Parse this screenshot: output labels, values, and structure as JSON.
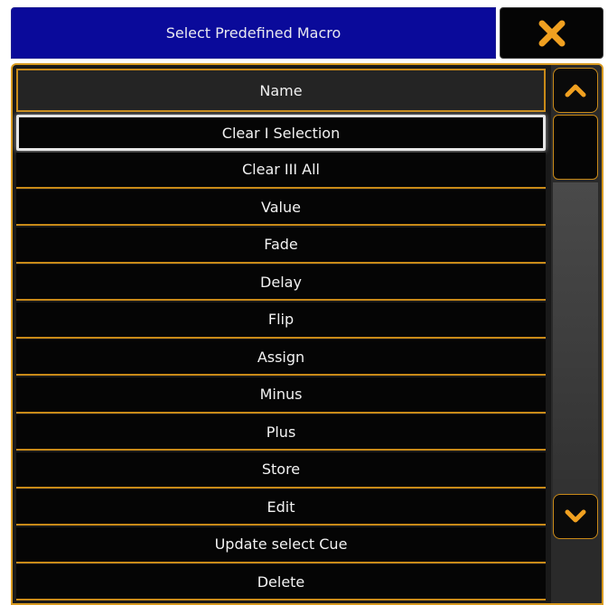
{
  "window": {
    "title": "Select Predefined Macro",
    "close_icon": "close-x-icon",
    "accent_color": "#d89a20",
    "title_bg": "#0a0a9a"
  },
  "table": {
    "column_header": "Name",
    "rows": [
      {
        "label": "Clear I Selection",
        "selected": true
      },
      {
        "label": "Clear III All",
        "selected": false
      },
      {
        "label": "Value",
        "selected": false
      },
      {
        "label": "Fade",
        "selected": false
      },
      {
        "label": "Delay",
        "selected": false
      },
      {
        "label": "Flip",
        "selected": false
      },
      {
        "label": "Assign",
        "selected": false
      },
      {
        "label": "Minus",
        "selected": false
      },
      {
        "label": "Plus",
        "selected": false
      },
      {
        "label": "Store",
        "selected": false
      },
      {
        "label": "Edit",
        "selected": false
      },
      {
        "label": "Update select Cue",
        "selected": false
      },
      {
        "label": "Delete",
        "selected": false
      }
    ]
  },
  "scrollbar": {
    "up_icon": "chevron-up-icon",
    "down_icon": "chevron-down-icon"
  }
}
